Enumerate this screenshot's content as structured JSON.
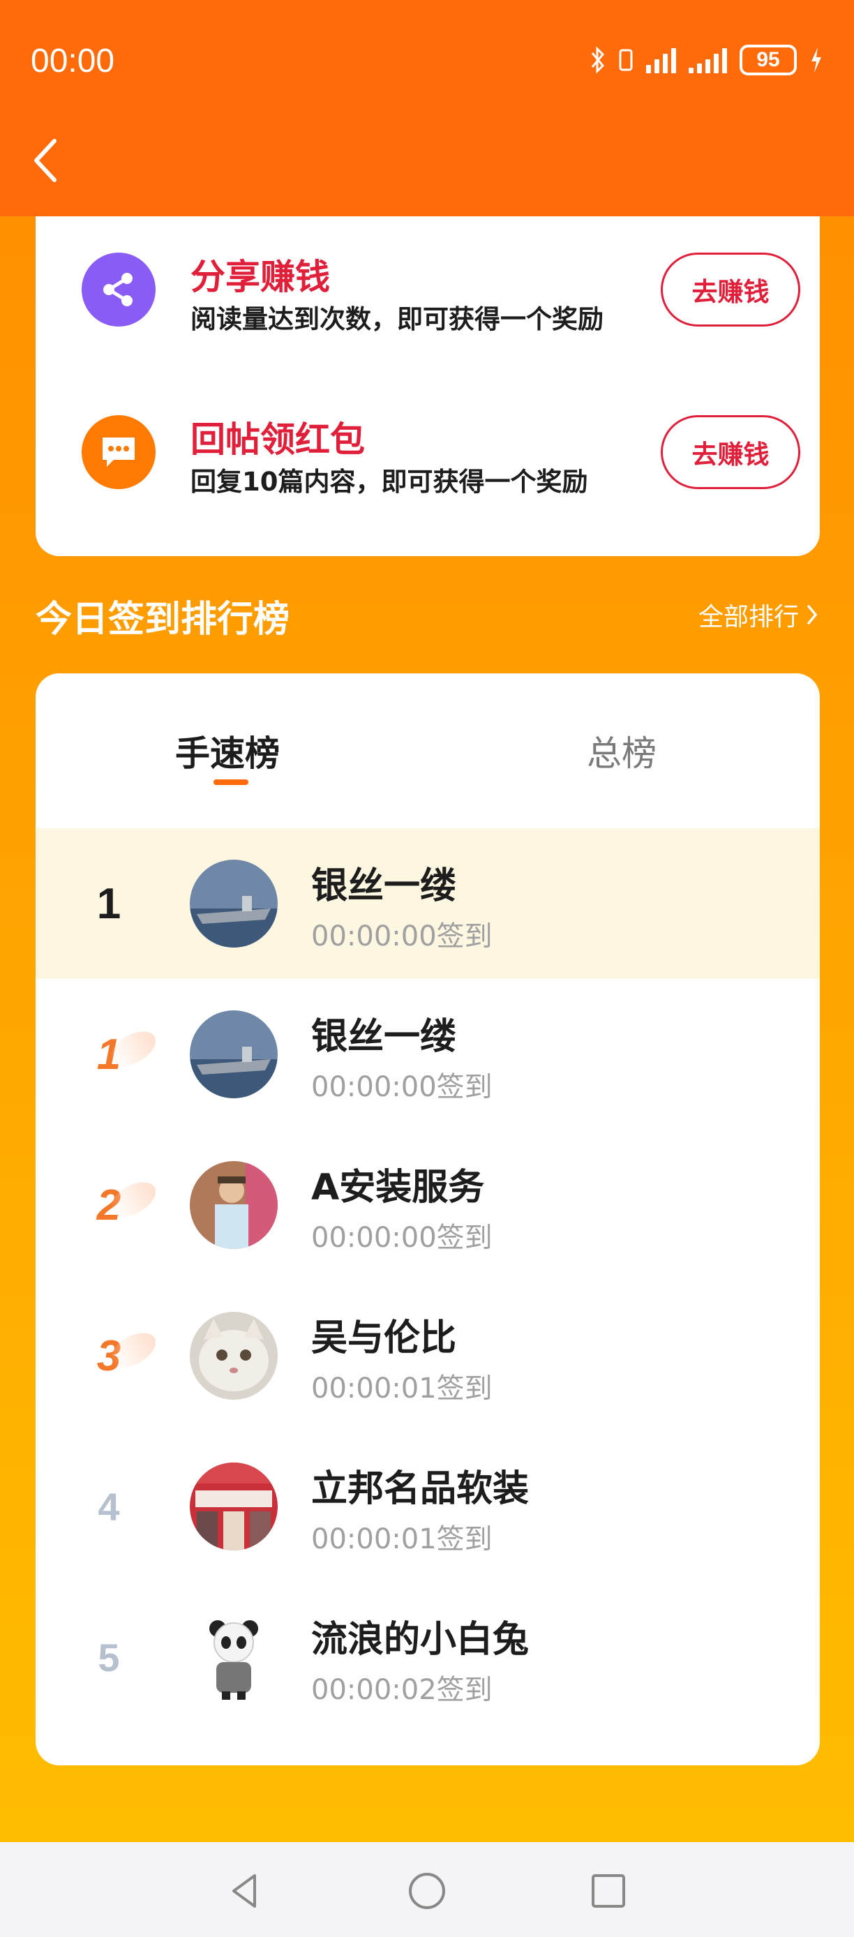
{
  "status_bar": {
    "time": "00:00",
    "battery": "95",
    "icons": [
      "bluetooth-icon",
      "vibrate-icon",
      "signal-icon",
      "signal-icon",
      "battery-icon",
      "charging-icon"
    ]
  },
  "nav": {
    "back_icon": "chevron-left-icon"
  },
  "tasks": [
    {
      "title": "分享赚钱",
      "desc": "阅读量达到次数，即可获得一个奖励",
      "button": "去赚钱",
      "icon": "share-icon",
      "color": "#8a5cf6"
    },
    {
      "title": "回帖领红包",
      "desc": "回复10篇内容，即可获得一个奖励",
      "button": "去赚钱",
      "icon": "chat-bubble-icon",
      "color": "#ff7a00"
    }
  ],
  "leaderboard": {
    "title": "今日签到排行榜",
    "all_link": "全部排行",
    "tabs": [
      "手速榜",
      "总榜"
    ],
    "active_tab": "手速榜",
    "rows": [
      {
        "rank": "1",
        "name": "银丝一缕",
        "time": "00:00:00签到",
        "avatar": "aircraft-carrier-avatar",
        "highlight": true
      },
      {
        "rank": "1",
        "name": "银丝一缕",
        "time": "00:00:00签到",
        "avatar": "aircraft-carrier-avatar"
      },
      {
        "rank": "2",
        "name": "A安装服务",
        "time": "00:00:00签到",
        "avatar": "person-avatar"
      },
      {
        "rank": "3",
        "name": "吴与伦比",
        "time": "00:00:01签到",
        "avatar": "cat-avatar"
      },
      {
        "rank": "4",
        "name": "立邦名品软装",
        "time": "00:00:01签到",
        "avatar": "storefront-avatar"
      },
      {
        "rank": "5",
        "name": "流浪的小白兔",
        "time": "00:00:02签到",
        "avatar": "panda-avatar"
      }
    ]
  },
  "system_nav": [
    "back-triangle-icon",
    "home-circle-icon",
    "recents-square-icon"
  ]
}
